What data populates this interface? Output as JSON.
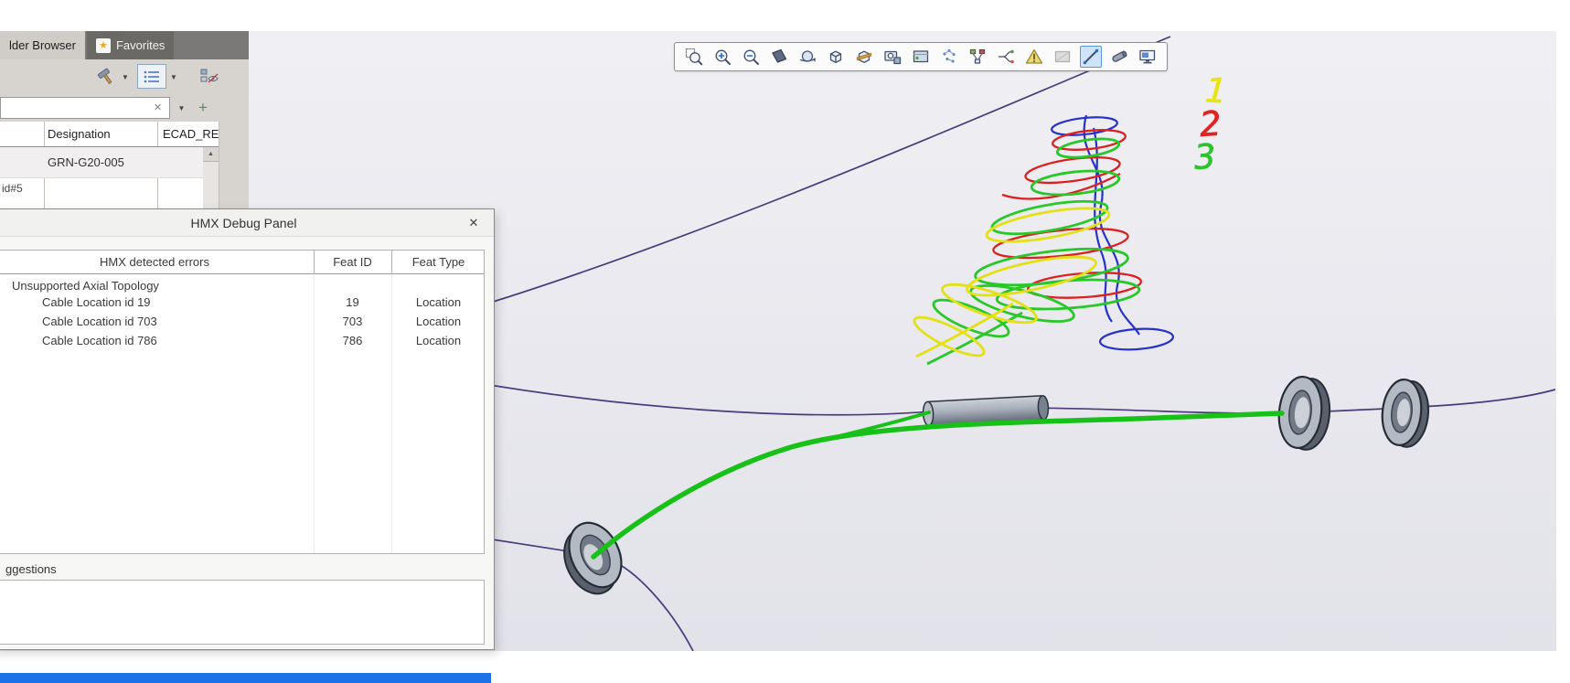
{
  "window": {
    "bottom_bar_color": "#1d72e8"
  },
  "icons": {
    "caret": "▼",
    "clear": "✕",
    "plus": "+",
    "up_arrow": "▲",
    "close": "✕",
    "star": "★"
  },
  "browser_panel": {
    "tabs": [
      {
        "label": "lder Browser",
        "active": true
      },
      {
        "label": "Favorites",
        "active": false,
        "icon": "star-icon"
      }
    ],
    "toolbar": {
      "icons": [
        "customize-tools-icon",
        "list-view-icon",
        "hide-columns-icon"
      ]
    },
    "search": {
      "value": ""
    },
    "table": {
      "columns": [
        "Designation",
        "ECAD_RE"
      ],
      "rows": [
        {
          "designation": "GRN-G20-005"
        }
      ],
      "partial_row_text": "id#5"
    }
  },
  "debug_panel": {
    "title": "HMX Debug Panel",
    "errors_table": {
      "columns": [
        "HMX detected errors",
        "Feat ID",
        "Feat Type"
      ],
      "group_label": "Unsupported Axial Topology",
      "rows": [
        {
          "error": "Cable Location id 19",
          "feat_id": "19",
          "feat_type": "Location"
        },
        {
          "error": "Cable Location id 703",
          "feat_id": "703",
          "feat_type": "Location"
        },
        {
          "error": "Cable Location id 786",
          "feat_id": "786",
          "feat_type": "Location"
        }
      ]
    },
    "suggestions_label": "ggestions"
  },
  "viewport": {
    "toolbar": {
      "icons": [
        {
          "name": "zoom-box"
        },
        {
          "name": "zoom-in"
        },
        {
          "name": "zoom-out"
        },
        {
          "name": "shade-plane"
        },
        {
          "name": "orbit-rotate"
        },
        {
          "name": "isometric-cube"
        },
        {
          "name": "section-cube"
        },
        {
          "name": "snapshot"
        },
        {
          "name": "render-style"
        },
        {
          "name": "particles"
        },
        {
          "name": "hierarchy"
        },
        {
          "name": "split-route"
        },
        {
          "name": "warnings"
        },
        {
          "name": "capture-disabled"
        },
        {
          "name": "measure-line",
          "selected": true
        },
        {
          "name": "connector"
        },
        {
          "name": "display-settings"
        }
      ]
    },
    "annotations": [
      {
        "label": "1",
        "color": "#e8e41a"
      },
      {
        "label": "2",
        "color": "#e02222"
      },
      {
        "label": "3",
        "color": "#2cc42c"
      }
    ],
    "colors": {
      "background": "#e8e8ee",
      "cable_green": "#17c117",
      "centerline_purple": "#4b3a7c"
    }
  }
}
